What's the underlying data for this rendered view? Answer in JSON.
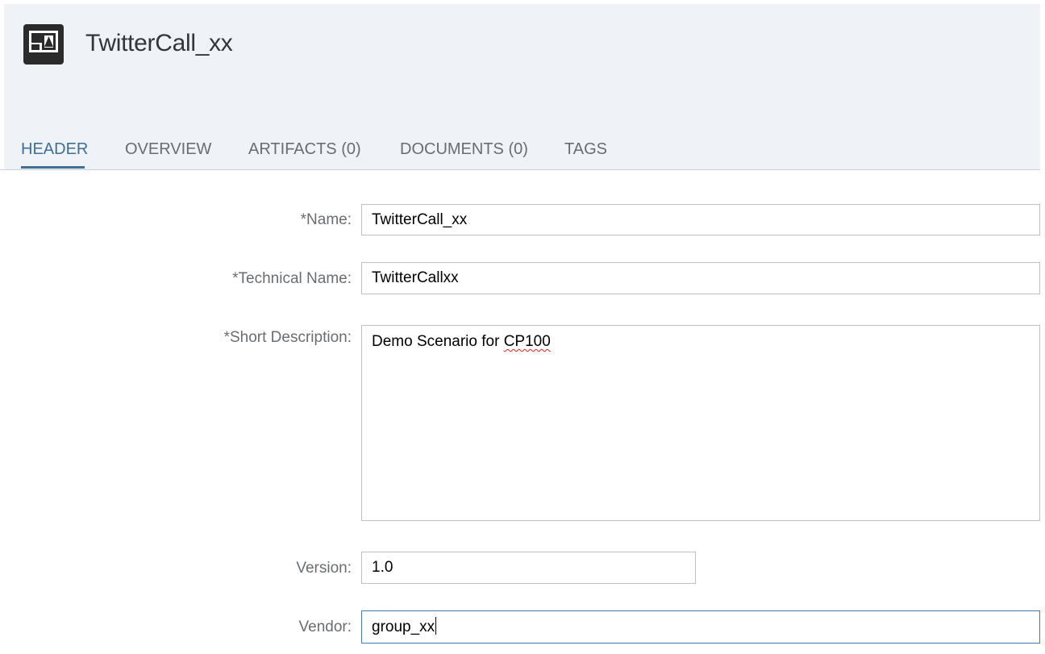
{
  "page": {
    "title": "TwitterCall_xx",
    "icon": "package-icon"
  },
  "tabs": [
    {
      "label": "HEADER",
      "active": true
    },
    {
      "label": "OVERVIEW",
      "active": false
    },
    {
      "label": "ARTIFACTS (0)",
      "active": false
    },
    {
      "label": "DOCUMENTS (0)",
      "active": false
    },
    {
      "label": "TAGS",
      "active": false
    }
  ],
  "form": {
    "name": {
      "label": "*Name:",
      "value": "TwitterCall_xx"
    },
    "technical_name": {
      "label": "*Technical Name:",
      "value": "TwitterCallxx"
    },
    "short_description": {
      "label": "*Short Description:",
      "value_plain": "Demo Scenario for ",
      "value_flagged": "CP100"
    },
    "version": {
      "label": "Version:",
      "value": "1.0"
    },
    "vendor": {
      "label": "Vendor:",
      "value": "group_xx"
    }
  },
  "colors": {
    "header_bg": "#eff2f7",
    "accent": "#3e6f96",
    "label_text": "#6a6d70",
    "focus_border": "#427cac"
  }
}
